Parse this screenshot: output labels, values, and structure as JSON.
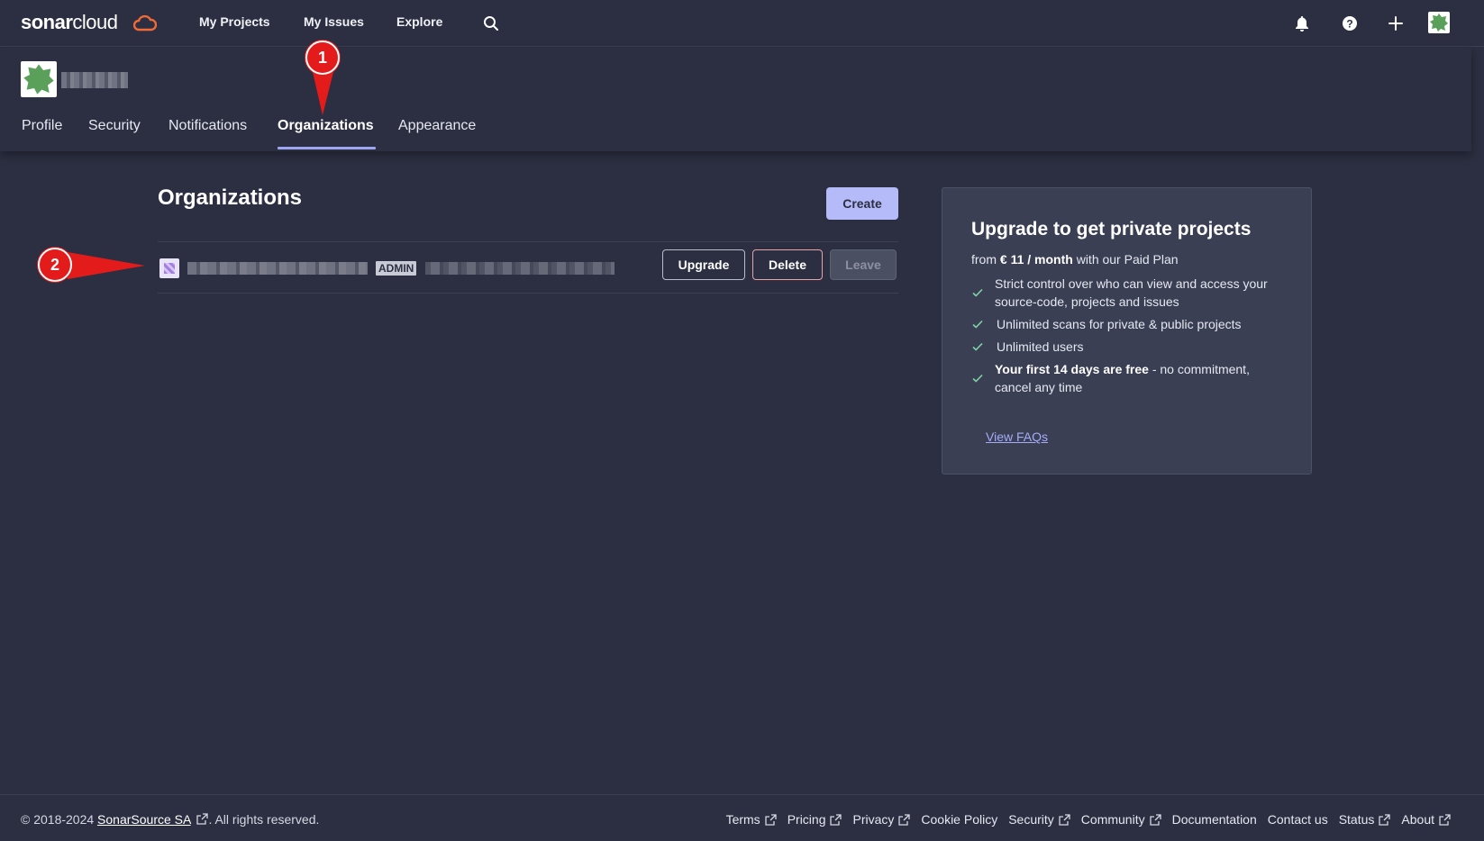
{
  "app": {
    "logo_bold": "sonar",
    "logo_light": "cloud"
  },
  "topnav": {
    "links": [
      "My Projects",
      "My Issues",
      "Explore"
    ]
  },
  "tabs": [
    "Profile",
    "Security",
    "Notifications",
    "Organizations",
    "Appearance"
  ],
  "active_tab": "Organizations",
  "main": {
    "title": "Organizations",
    "create_label": "Create",
    "org_row": {
      "badge": "ADMIN",
      "upgrade_label": "Upgrade",
      "delete_label": "Delete",
      "leave_label": "Leave"
    }
  },
  "upgrade_card": {
    "title": "Upgrade to get private projects",
    "sub_prefix": "from",
    "sub_price": "€ 11 / month",
    "sub_suffix": "with our Paid Plan",
    "features": [
      "Strict control over who can view and access your source-code, projects and issues",
      "Unlimited scans for private & public projects",
      "Unlimited users"
    ],
    "trial_bold": "Your first 14 days are free",
    "trial_rest": "- no commitment, cancel any time",
    "faq_label": "View FAQs"
  },
  "footer": {
    "copy_prefix": "© 2018-2024",
    "copy_link": "SonarSource SA",
    "copy_suffix": ". All rights reserved.",
    "links": [
      "Terms",
      "Pricing",
      "Privacy",
      "Cookie Policy",
      "Security",
      "Community",
      "Documentation",
      "Contact us",
      "Status",
      "About"
    ]
  },
  "annotations": [
    "1",
    "2"
  ],
  "colors": {
    "background": "#2b2f41",
    "accent": "#b5bbf9",
    "card": "#3a3f54",
    "marker": "#e41b1b",
    "check": "#7ed3a6"
  }
}
